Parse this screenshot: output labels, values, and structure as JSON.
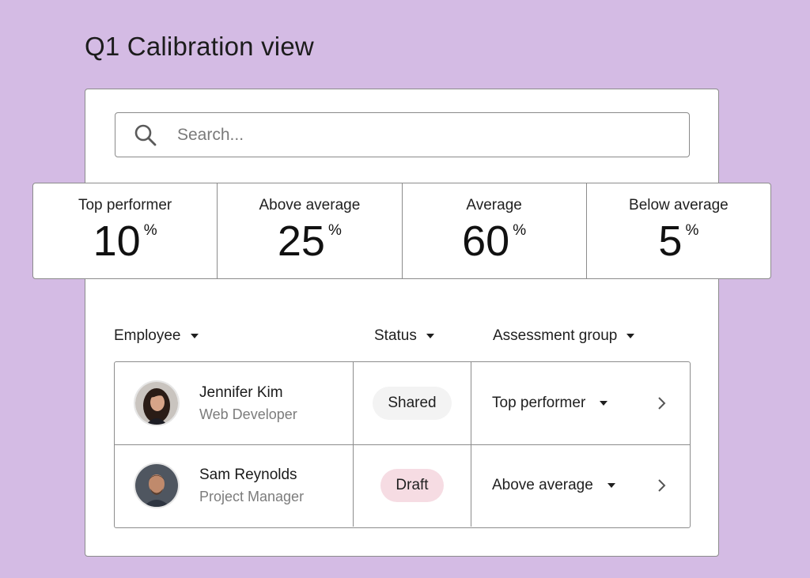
{
  "page": {
    "title": "Q1 Calibration view"
  },
  "search": {
    "placeholder": "Search...",
    "icon": "search-icon"
  },
  "stats": [
    {
      "label": "Top performer",
      "value": "10",
      "unit": "%"
    },
    {
      "label": "Above average",
      "value": "25",
      "unit": "%"
    },
    {
      "label": "Average",
      "value": "60",
      "unit": "%"
    },
    {
      "label": "Below average",
      "value": "5",
      "unit": "%"
    }
  ],
  "table": {
    "columns": {
      "employee": "Employee",
      "status": "Status",
      "group": "Assessment group"
    },
    "rows": [
      {
        "name": "Jennifer Kim",
        "role": "Web Developer",
        "status": "Shared",
        "group": "Top performer"
      },
      {
        "name": "Sam Reynolds",
        "role": "Project Manager",
        "status": "Draft",
        "group": "Above average"
      }
    ]
  },
  "colors": {
    "background": "#d4bbe4",
    "border": "#8c8c8c",
    "shared_pill": "#f3f3f3",
    "draft_pill": "#f6dce3"
  }
}
